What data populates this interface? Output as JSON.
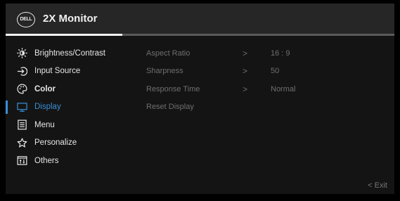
{
  "header": {
    "brand": "DELL",
    "title": "2X Monitor",
    "progress": 0.3
  },
  "menu": [
    {
      "key": "brightness",
      "label": "Brightness/Contrast"
    },
    {
      "key": "input",
      "label": "Input Source"
    },
    {
      "key": "color",
      "label": "Color"
    },
    {
      "key": "display",
      "label": "Display"
    },
    {
      "key": "menu",
      "label": "Menu"
    },
    {
      "key": "personalize",
      "label": "Personalize"
    },
    {
      "key": "others",
      "label": "Others"
    }
  ],
  "state": {
    "active_item": "display",
    "selected_item": "color"
  },
  "submenu": [
    {
      "label": "Aspect Ratio",
      "chevron": ">",
      "value": "16 : 9"
    },
    {
      "label": "Sharpness",
      "chevron": ">",
      "value": "50"
    },
    {
      "label": "Response Time",
      "chevron": ">",
      "value": "Normal"
    },
    {
      "label": "Reset Display",
      "chevron": "",
      "value": ""
    }
  ],
  "footer": {
    "exit_label": "< Exit"
  },
  "colors": {
    "accent": "#3a8fd6",
    "text": "#e6e6e6",
    "dim": "#6f6f6f",
    "header_bg": "#262626",
    "panel_bg": "#141414"
  }
}
